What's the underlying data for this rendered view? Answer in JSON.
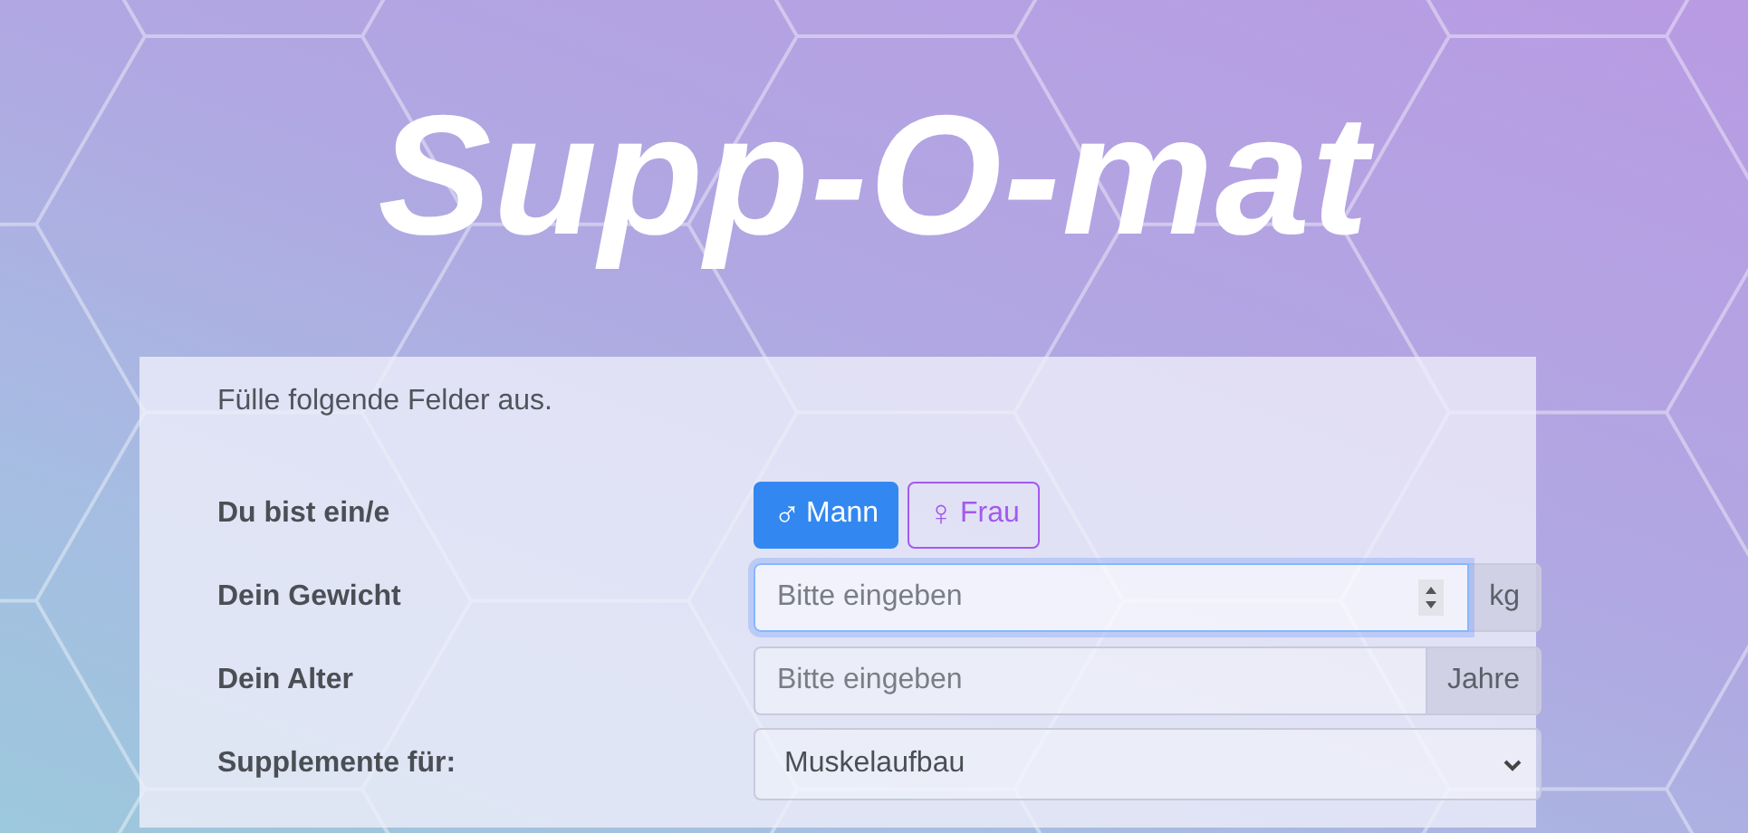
{
  "title": "Supp-O-mat",
  "intro": "Fülle folgende Felder aus.",
  "form": {
    "rows": [
      {
        "kind": "toggle",
        "label": "Du bist ein/e",
        "options": [
          {
            "symbol": "♂",
            "label": "Mann",
            "selected": true
          },
          {
            "symbol": "♀",
            "label": "Frau",
            "selected": false
          }
        ]
      },
      {
        "kind": "number",
        "label": "Dein Gewicht",
        "placeholder": "Bitte eingeben",
        "unit": "kg",
        "focused": true
      },
      {
        "kind": "number",
        "label": "Dein Alter",
        "placeholder": "Bitte eingeben",
        "unit": "Jahre",
        "focused": false
      },
      {
        "kind": "select",
        "label": "Supplemente für:",
        "value": "Muskelaufbau"
      }
    ]
  }
}
